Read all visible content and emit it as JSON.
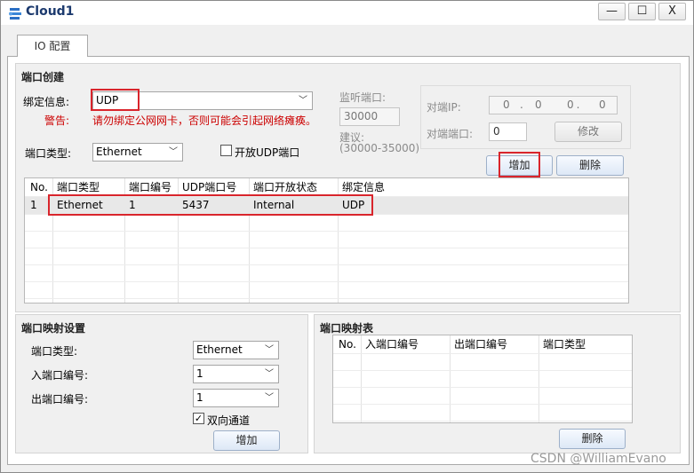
{
  "window": {
    "title": "Cloud1",
    "icon": "cloud-app-icon",
    "minimize_glyph": "—",
    "maximize_glyph": "☐",
    "close_glyph": "X"
  },
  "tabs": [
    {
      "label": "IO 配置",
      "active": true
    }
  ],
  "port_create": {
    "group_title": "端口创建",
    "bind_label": "绑定信息:",
    "bind_value": "UDP",
    "warning_label": "警告:",
    "warning_text": "请勿绑定公网网卡，否则可能会引起网络瘫痪。",
    "port_type_label": "端口类型:",
    "port_type_value": "Ethernet",
    "open_udp_label": "开放UDP端口",
    "open_udp_checked": false,
    "listen_port_label": "监听端口:",
    "listen_port_value": "30000",
    "suggest_label": "建议:",
    "suggest_range": "(30000-35000)",
    "peer_ip_label": "对端IP:",
    "peer_ip_value": ". . .",
    "peer_ip_octets": [
      "0",
      "0",
      "0",
      "0"
    ],
    "peer_port_label": "对端端口:",
    "peer_port_value": "0",
    "modify_button": "修改",
    "add_button": "增加",
    "delete_button": "删除",
    "table": {
      "columns": [
        "No.",
        "端口类型",
        "端口编号",
        "UDP端口号",
        "端口开放状态",
        "绑定信息"
      ],
      "rows": [
        [
          "1",
          "Ethernet",
          "1",
          "5437",
          "Internal",
          "UDP"
        ]
      ]
    }
  },
  "port_map_settings": {
    "group_title": "端口映射设置",
    "port_type_label": "端口类型:",
    "port_type_value": "Ethernet",
    "in_port_label": "入端口编号:",
    "in_port_value": "1",
    "out_port_label": "出端口编号:",
    "out_port_value": "1",
    "bidirectional_label": "双向通道",
    "bidirectional_checked": true,
    "add_button": "增加"
  },
  "port_map_table": {
    "group_title": "端口映射表",
    "columns": [
      "No.",
      "入端口编号",
      "出端口编号",
      "端口类型"
    ],
    "rows": [],
    "delete_button": "删除"
  },
  "watermark": "CSDN @WilliamEvano",
  "colors": {
    "highlight_box": "#d9252c",
    "warning_text": "#cc0000",
    "title_text": "#1c3a6e"
  }
}
